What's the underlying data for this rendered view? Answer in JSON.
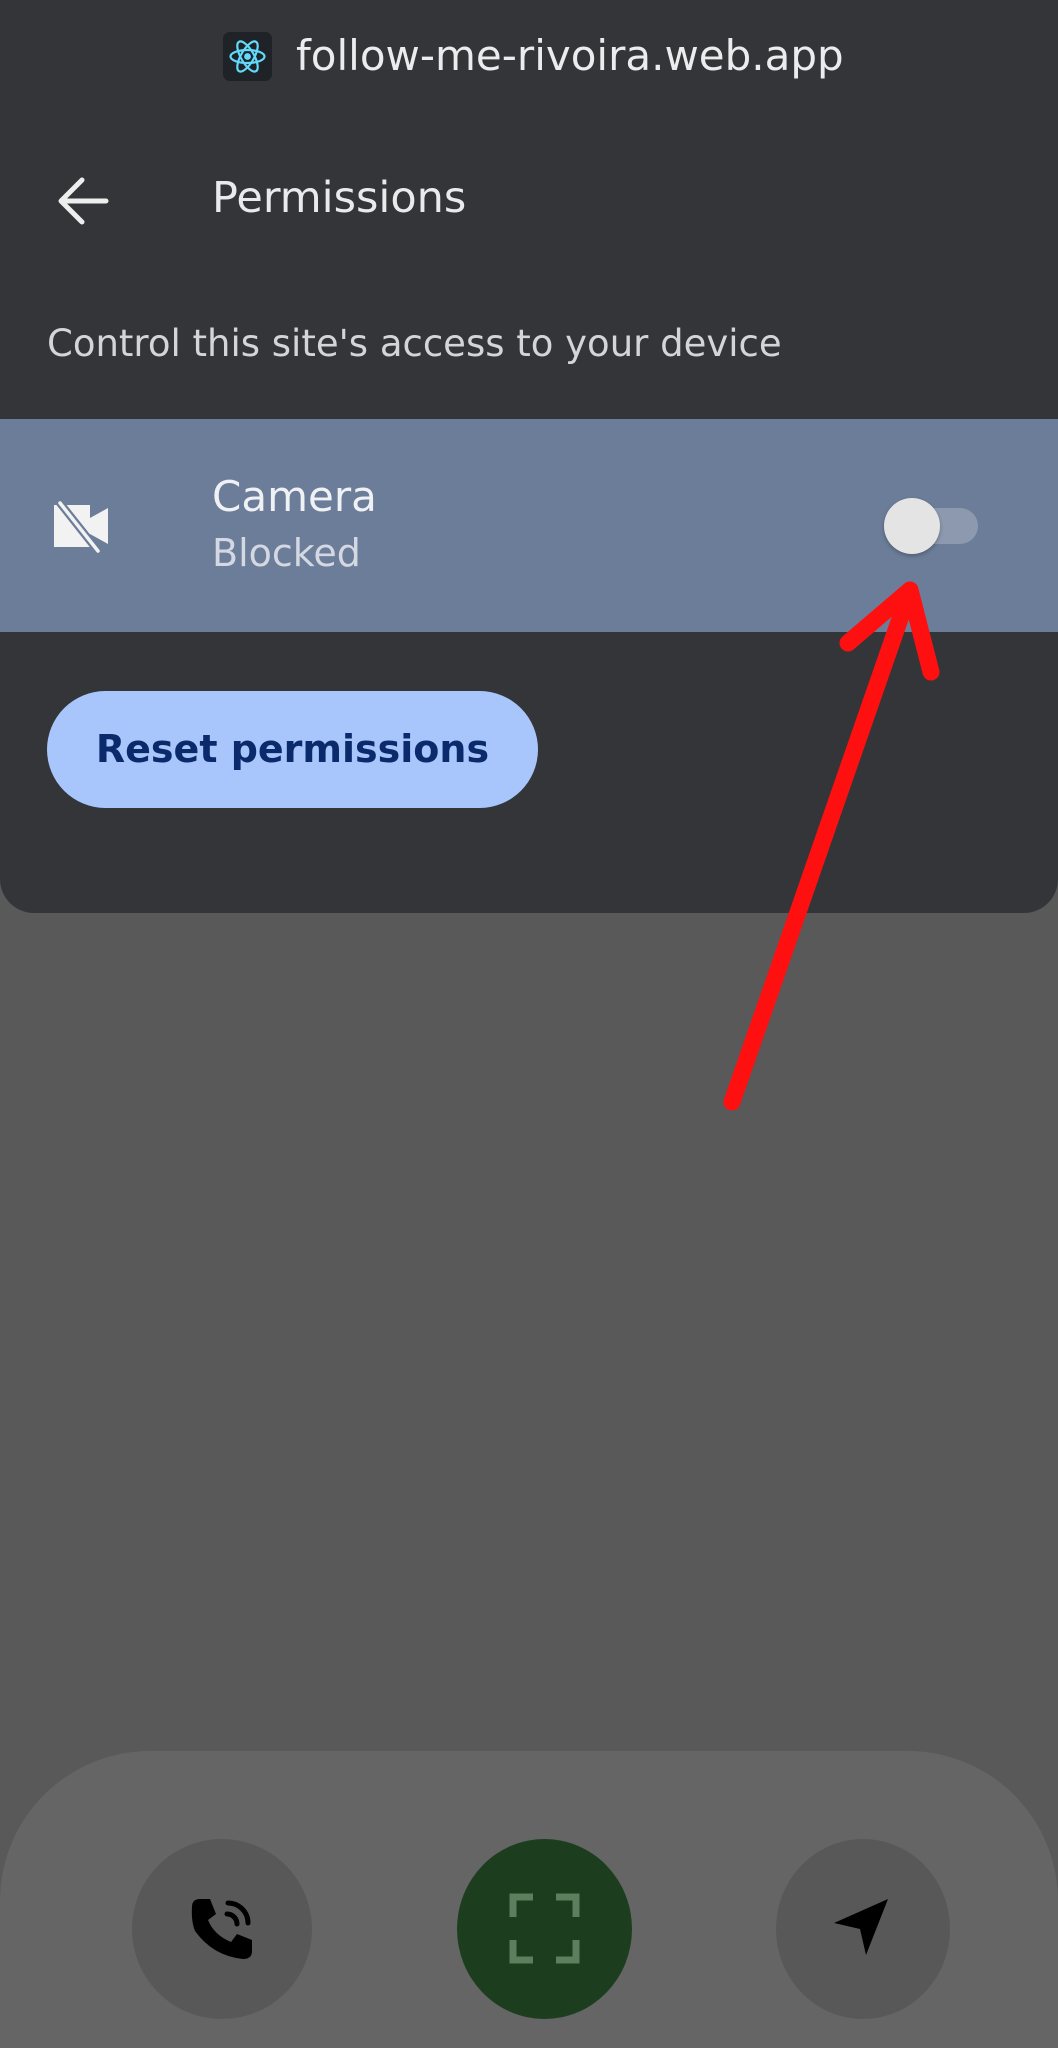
{
  "header": {
    "favicon": "react-atom-icon",
    "url": "follow-me-rivoira.web.app"
  },
  "permissions": {
    "title": "Permissions",
    "back_icon": "arrow-left-icon",
    "description": "Control this site's access to your device",
    "camera": {
      "icon": "camera-off-icon",
      "label": "Camera",
      "status": "Blocked",
      "toggle_on": false
    },
    "reset_label": "Reset permissions"
  },
  "dock": {
    "buttons": [
      {
        "name": "call",
        "icon": "phone-call-icon"
      },
      {
        "name": "scan",
        "icon": "scan-frame-icon"
      },
      {
        "name": "navigate",
        "icon": "navigation-arrow-icon"
      }
    ]
  },
  "colors": {
    "sheet_bg": "#343538",
    "row_highlight": "#6c7d99",
    "reset_button_bg": "#a8c6fb",
    "reset_button_text": "#0a2a6b",
    "annotation_arrow": "#ff1010",
    "scan_button_bg": "#1d3d1f",
    "page_bg": "#595959"
  }
}
